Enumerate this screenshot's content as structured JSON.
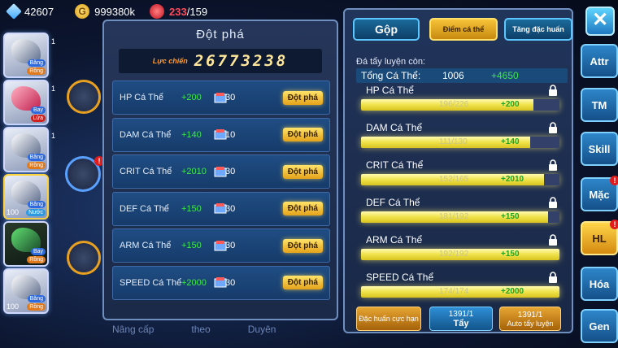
{
  "topbar": {
    "gems": "42607",
    "gold": "999380k",
    "energy_current": "233",
    "energy_max": "/159"
  },
  "left_panel": {
    "title": "Đột phá",
    "power_label": "Lực chiến",
    "power_value": "26773238",
    "rows": [
      {
        "name": "HP Cá Thể",
        "bonus": "+200",
        "cost": "30",
        "button": "Đột phá"
      },
      {
        "name": "DAM Cá Thể",
        "bonus": "+140",
        "cost": "10",
        "button": "Đột phá"
      },
      {
        "name": "CRIT Cá Thể",
        "bonus": "+2010",
        "cost": "30",
        "button": "Đột phá"
      },
      {
        "name": "DEF Cá Thể",
        "bonus": "+150",
        "cost": "30",
        "button": "Đột phá"
      },
      {
        "name": "ARM Cá Thể",
        "bonus": "+150",
        "cost": "30",
        "button": "Đột phá"
      },
      {
        "name": "SPEED Cá Thể",
        "bonus": "+2000",
        "cost": "30",
        "button": "Đột phá"
      }
    ]
  },
  "right_panel": {
    "tabs": {
      "gop": "Gộp",
      "diem": "Điểm cá thể",
      "tang": "Tăng đặc huấn"
    },
    "remaining_label": "Đá tẩy luyện còn:",
    "total_label": "Tổng Cá Thể:",
    "total_value": "1006",
    "total_bonus": "+4650",
    "stats": [
      {
        "name": "HP Cá Thể",
        "progress": "196/226",
        "ratio": 0.867,
        "bonus": "+200"
      },
      {
        "name": "DAM Cá Thể",
        "progress": "111/130",
        "ratio": 0.854,
        "bonus": "+140"
      },
      {
        "name": "CRIT Cá Thể",
        "progress": "152/165",
        "ratio": 0.921,
        "bonus": "+2010"
      },
      {
        "name": "DEF Cá Thể",
        "progress": "181/192",
        "ratio": 0.943,
        "bonus": "+150"
      },
      {
        "name": "ARM Cá Thể",
        "progress": "192/192",
        "ratio": 1.0,
        "bonus": "+150"
      },
      {
        "name": "SPEED Cá Thể",
        "progress": "174/174",
        "ratio": 1.0,
        "bonus": "+2000"
      }
    ],
    "buttons": {
      "dac_huan": "Đặc huấn cực hạn",
      "tay_count": "1391/1",
      "tay": "Tẩy",
      "auto_count": "1391/1",
      "auto": "Auto tẩy luyện"
    }
  },
  "side_menu": [
    "Attr",
    "TM",
    "Skill",
    "Mặc",
    "HL",
    "Hóa",
    "Gen"
  ],
  "characters": [
    {
      "level": "1",
      "tag1": "Băng",
      "tag2": "Rồng"
    },
    {
      "level": "1",
      "tag1": "Bay",
      "tag2": "Lửa"
    },
    {
      "level": "1",
      "tag1": "Băng",
      "tag2": "Rồng"
    },
    {
      "level": "100",
      "tag1": "Băng",
      "tag2": "Nước"
    },
    {
      "level": "",
      "tag1": "Bay",
      "tag2": "Rồng"
    },
    {
      "level": "100",
      "tag1": "Băng",
      "tag2": "Rồng"
    }
  ],
  "bottom_tabs": [
    "Nâng cấp",
    "theo",
    "Duyên"
  ],
  "colors": {
    "accent_gold": "#f6c338",
    "bonus_green": "#3fe64a",
    "bar_yellow": "#f0e24a"
  }
}
